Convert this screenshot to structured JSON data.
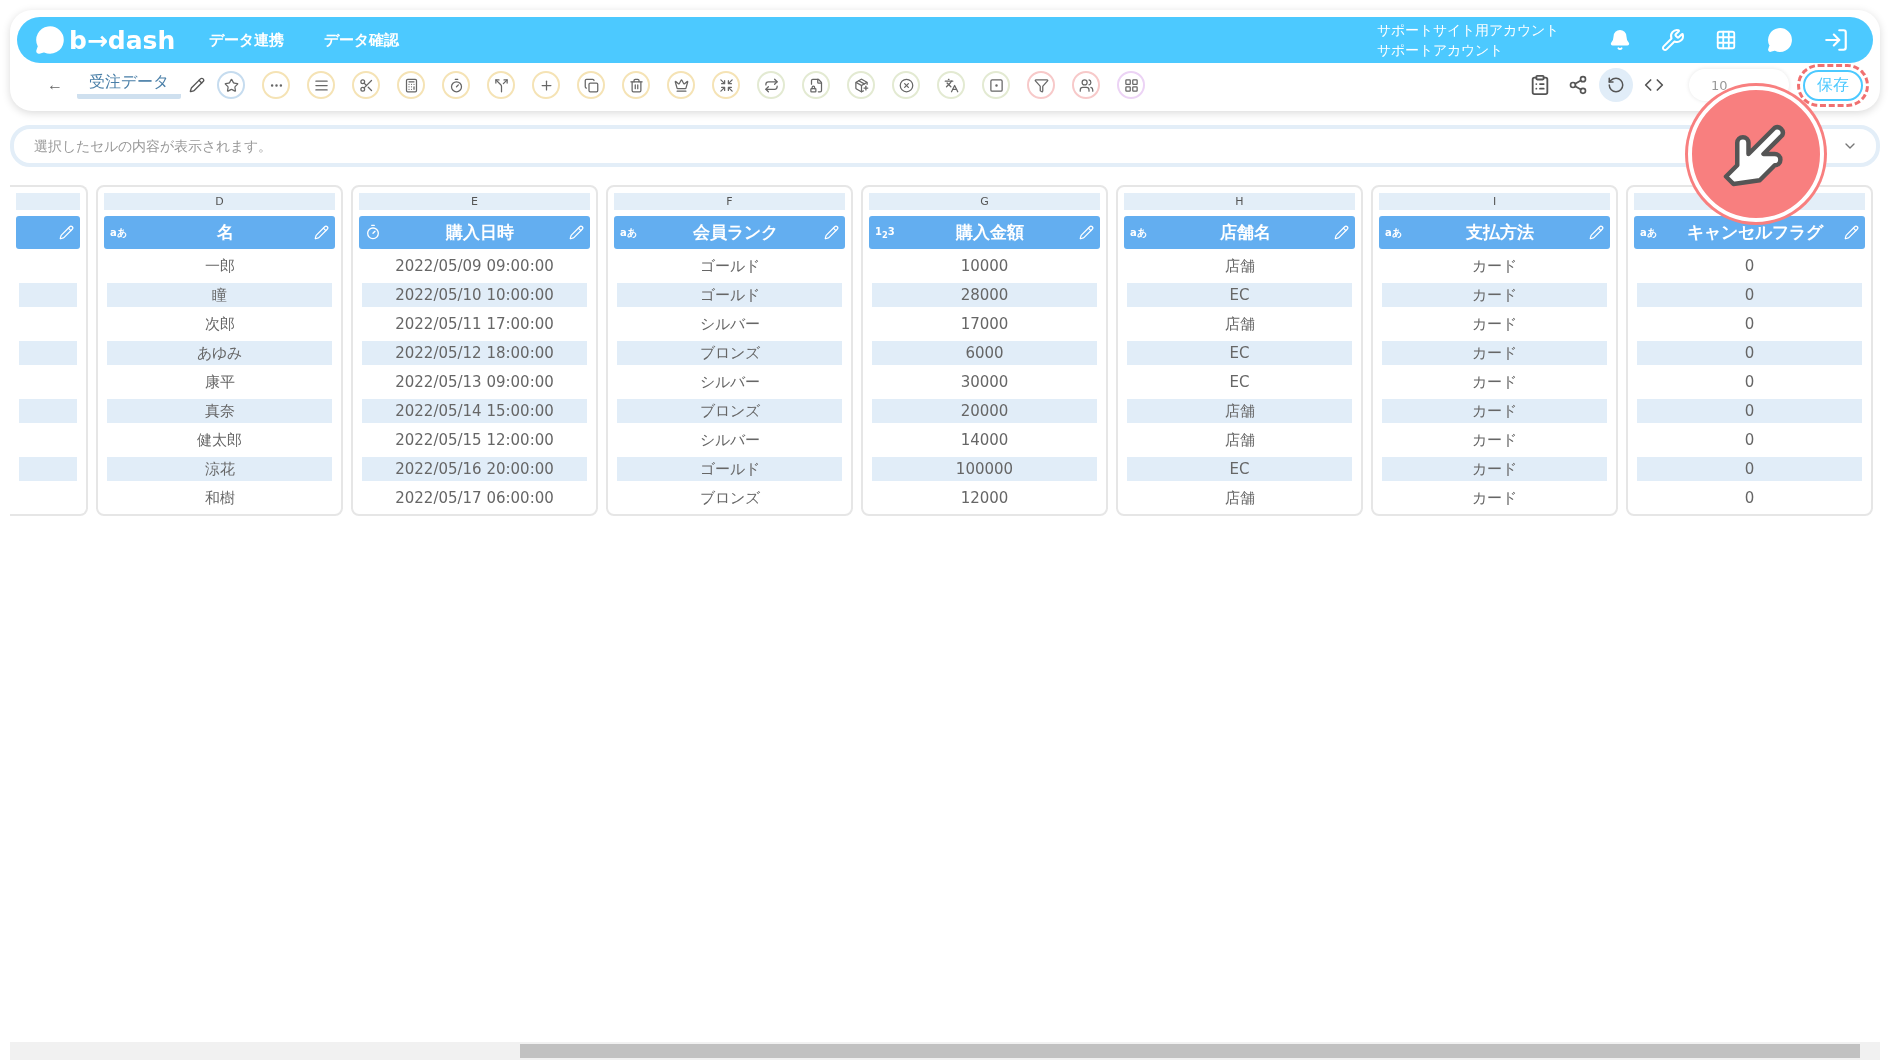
{
  "header": {
    "logo": "b→dash",
    "nav": [
      {
        "label": "データ連携"
      },
      {
        "label": "データ確認"
      }
    ],
    "account": {
      "site": "サポートサイト用アカウント",
      "user": "サポートアカウント"
    }
  },
  "toolbar": {
    "back": "←",
    "title": "受注データ",
    "zoom": "10",
    "save": "保存"
  },
  "formula_bar": {
    "placeholder": "選択したセルの内容が表示されます。"
  },
  "columns": [
    {
      "kind": "partial"
    },
    {
      "letter": "D",
      "kind": "text",
      "badge": "aあ",
      "name": "名",
      "cells": [
        "一郎",
        "瞳",
        "次郎",
        "あゆみ",
        "康平",
        "真奈",
        "健太郎",
        "涼花",
        "和樹"
      ]
    },
    {
      "letter": "E",
      "kind": "datetime",
      "name": "購入日時",
      "cells": [
        "2022/05/09 09:00:00",
        "2022/05/10 10:00:00",
        "2022/05/11 17:00:00",
        "2022/05/12 18:00:00",
        "2022/05/13 09:00:00",
        "2022/05/14 15:00:00",
        "2022/05/15 12:00:00",
        "2022/05/16 20:00:00",
        "2022/05/17 06:00:00"
      ]
    },
    {
      "letter": "F",
      "kind": "text",
      "badge": "aあ",
      "name": "会員ランク",
      "cells": [
        "ゴールド",
        "ゴールド",
        "シルバー",
        "ブロンズ",
        "シルバー",
        "ブロンズ",
        "シルバー",
        "ゴールド",
        "ブロンズ"
      ]
    },
    {
      "letter": "G",
      "kind": "number",
      "badge": "1$_{2}$3",
      "name": "購入金額",
      "cells": [
        "10000",
        "28000",
        "17000",
        "6000",
        "30000",
        "20000",
        "14000",
        "100000",
        "12000"
      ]
    },
    {
      "letter": "H",
      "kind": "text",
      "badge": "aあ",
      "name": "店舗名",
      "cells": [
        "店舗",
        "EC",
        "店舗",
        "EC",
        "EC",
        "店舗",
        "店舗",
        "EC",
        "店舗"
      ]
    },
    {
      "letter": "I",
      "kind": "text",
      "badge": "aあ",
      "name": "支払方法",
      "cells": [
        "カード",
        "カード",
        "カード",
        "カード",
        "カード",
        "カード",
        "カード",
        "カード",
        "カード"
      ]
    },
    {
      "kind": "text",
      "badge": "aあ",
      "name": "キャンセルフラグ",
      "cells": [
        "0",
        "0",
        "0",
        "0",
        "0",
        "0",
        "0",
        "0",
        "0"
      ]
    }
  ]
}
